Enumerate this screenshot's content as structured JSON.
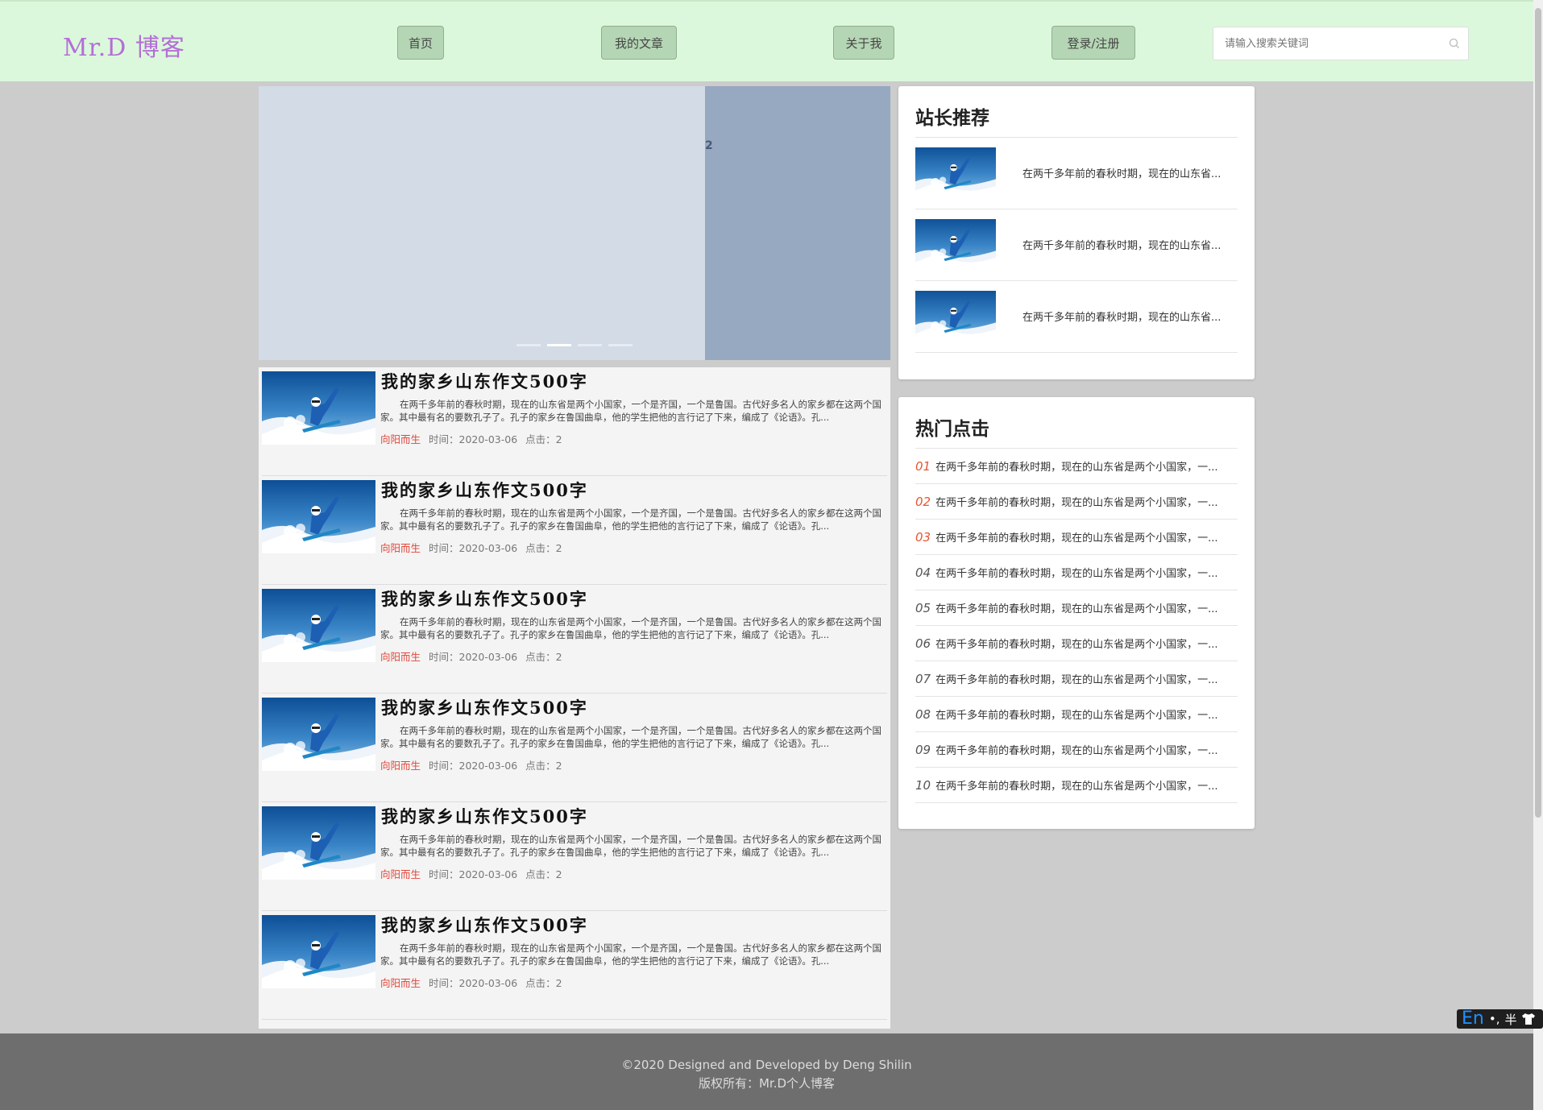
{
  "header": {
    "logo": "Mr.D 博客",
    "nav": [
      {
        "label": "首页"
      },
      {
        "label": "我的文章"
      },
      {
        "label": "关于我"
      },
      {
        "label": "登录/注册"
      }
    ],
    "search_placeholder": "请输入搜索关键词",
    "bg_color": "#dcf8dc"
  },
  "carousel": {
    "slide_label": "2",
    "dots_count": 4,
    "active_dot": 2
  },
  "articles": [
    {
      "title": "我的家乡山东作文500字",
      "summary": "在两千多年前的春秋时期，现在的山东省是两个小国家，一个是齐国，一个是鲁国。古代好多名人的家乡都在这两个国家。其中最有名的要数孔子了。孔子的家乡在鲁国曲阜，他的学生把他的言行记了下来，编成了《论语》。孔...",
      "author": "向阳而生",
      "time_label": "时间：2020-03-06",
      "clicks_label": "点击：2"
    },
    {
      "title": "我的家乡山东作文500字",
      "summary": "在两千多年前的春秋时期，现在的山东省是两个小国家，一个是齐国，一个是鲁国。古代好多名人的家乡都在这两个国家。其中最有名的要数孔子了。孔子的家乡在鲁国曲阜，他的学生把他的言行记了下来，编成了《论语》。孔...",
      "author": "向阳而生",
      "time_label": "时间：2020-03-06",
      "clicks_label": "点击：2"
    },
    {
      "title": "我的家乡山东作文500字",
      "summary": "在两千多年前的春秋时期，现在的山东省是两个小国家，一个是齐国，一个是鲁国。古代好多名人的家乡都在这两个国家。其中最有名的要数孔子了。孔子的家乡在鲁国曲阜，他的学生把他的言行记了下来，编成了《论语》。孔...",
      "author": "向阳而生",
      "time_label": "时间：2020-03-06",
      "clicks_label": "点击：2"
    },
    {
      "title": "我的家乡山东作文500字",
      "summary": "在两千多年前的春秋时期，现在的山东省是两个小国家，一个是齐国，一个是鲁国。古代好多名人的家乡都在这两个国家。其中最有名的要数孔子了。孔子的家乡在鲁国曲阜，他的学生把他的言行记了下来，编成了《论语》。孔...",
      "author": "向阳而生",
      "time_label": "时间：2020-03-06",
      "clicks_label": "点击：2"
    },
    {
      "title": "我的家乡山东作文500字",
      "summary": "在两千多年前的春秋时期，现在的山东省是两个小国家，一个是齐国，一个是鲁国。古代好多名人的家乡都在这两个国家。其中最有名的要数孔子了。孔子的家乡在鲁国曲阜，他的学生把他的言行记了下来，编成了《论语》。孔...",
      "author": "向阳而生",
      "time_label": "时间：2020-03-06",
      "clicks_label": "点击：2"
    },
    {
      "title": "我的家乡山东作文500字",
      "summary": "在两千多年前的春秋时期，现在的山东省是两个小国家，一个是齐国，一个是鲁国。古代好多名人的家乡都在这两个国家。其中最有名的要数孔子了。孔子的家乡在鲁国曲阜，他的学生把他的言行记了下来，编成了《论语》。孔...",
      "author": "向阳而生",
      "time_label": "时间：2020-03-06",
      "clicks_label": "点击：2"
    }
  ],
  "recommend": {
    "title": "站长推荐",
    "items": [
      {
        "text": "在两千多年前的春秋时期，现在的山东省..."
      },
      {
        "text": "在两千多年前的春秋时期，现在的山东省..."
      },
      {
        "text": "在两千多年前的春秋时期，现在的山东省..."
      }
    ]
  },
  "hot": {
    "title": "热门点击",
    "items": [
      {
        "num": "01",
        "text": "在两千多年前的春秋时期，现在的山东省是两个小国家，一..."
      },
      {
        "num": "02",
        "text": "在两千多年前的春秋时期，现在的山东省是两个小国家，一..."
      },
      {
        "num": "03",
        "text": "在两千多年前的春秋时期，现在的山东省是两个小国家，一..."
      },
      {
        "num": "04",
        "text": "在两千多年前的春秋时期，现在的山东省是两个小国家，一..."
      },
      {
        "num": "05",
        "text": "在两千多年前的春秋时期，现在的山东省是两个小国家，一..."
      },
      {
        "num": "06",
        "text": "在两千多年前的春秋时期，现在的山东省是两个小国家，一..."
      },
      {
        "num": "07",
        "text": "在两千多年前的春秋时期，现在的山东省是两个小国家，一..."
      },
      {
        "num": "08",
        "text": "在两千多年前的春秋时期，现在的山东省是两个小国家，一..."
      },
      {
        "num": "09",
        "text": "在两千多年前的春秋时期，现在的山东省是两个小国家，一..."
      },
      {
        "num": "10",
        "text": "在两千多年前的春秋时期，现在的山东省是两个小国家，一..."
      }
    ]
  },
  "footer": {
    "line1": "©2020 Designed and Developed by Deng Shilin",
    "line2": "版权所有：Mr.D个人博客"
  },
  "ime": {
    "lang": "En",
    "punct": "•,",
    "width": "半",
    "skin_icon": "shirt-icon"
  }
}
